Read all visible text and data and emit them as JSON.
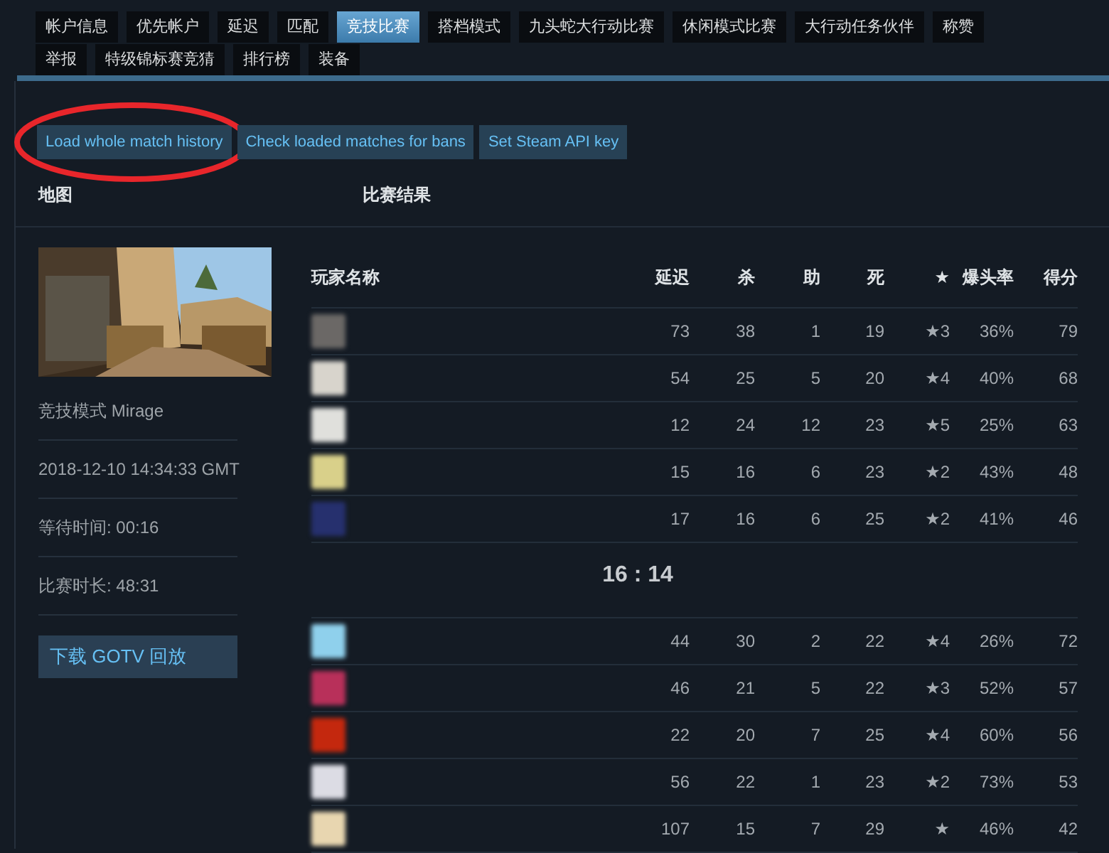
{
  "tabs": [
    {
      "label": "帐户信息",
      "selected": false
    },
    {
      "label": "优先帐户",
      "selected": false
    },
    {
      "label": "延迟",
      "selected": false
    },
    {
      "label": "匹配",
      "selected": false
    },
    {
      "label": "竞技比赛",
      "selected": true
    },
    {
      "label": "搭档模式",
      "selected": false
    },
    {
      "label": "九头蛇大行动比赛",
      "selected": false
    },
    {
      "label": "休闲模式比赛",
      "selected": false
    },
    {
      "label": "大行动任务伙伴",
      "selected": false
    },
    {
      "label": "称赞",
      "selected": false
    },
    {
      "label": "举报",
      "selected": false
    },
    {
      "label": "特级锦标赛竞猜",
      "selected": false
    },
    {
      "label": "排行榜",
      "selected": false
    },
    {
      "label": "装备",
      "selected": false
    }
  ],
  "actions": [
    {
      "label": "Load whole match history",
      "circled": true
    },
    {
      "label": "Check loaded matches for bans",
      "circled": false
    },
    {
      "label": "Set Steam API key",
      "circled": false
    }
  ],
  "map_panel": {
    "heading": "地图",
    "map_image": {
      "kind": "picture"
    },
    "details": [
      "竞技模式 Mirage",
      "2018-12-10 14:34:33 GMT",
      "等待时间: 00:16",
      "比赛时长: 48:31"
    ],
    "download_button": "下载 GOTV 回放"
  },
  "results": {
    "heading": "比赛结果",
    "columns": [
      "玩家名称",
      "延迟",
      "杀",
      "助",
      "死",
      "★",
      "爆头率",
      "得分"
    ],
    "teams": [
      {
        "players": [
          {
            "color": "#6b6866",
            "ping": "73",
            "kills": "38",
            "assists": "1",
            "deaths": "19",
            "mvp": "★3",
            "headshots": "36%",
            "score": "79"
          },
          {
            "color": "#d8d4cc",
            "ping": "54",
            "kills": "25",
            "assists": "5",
            "deaths": "20",
            "mvp": "★4",
            "headshots": "40%",
            "score": "68"
          },
          {
            "color": "#e0e0dc",
            "ping": "12",
            "kills": "24",
            "assists": "12",
            "deaths": "23",
            "mvp": "★5",
            "headshots": "25%",
            "score": "63"
          },
          {
            "color": "#d9d08a",
            "ping": "15",
            "kills": "16",
            "assists": "6",
            "deaths": "23",
            "mvp": "★2",
            "headshots": "43%",
            "score": "48"
          },
          {
            "color": "#26306e",
            "ping": "17",
            "kills": "16",
            "assists": "6",
            "deaths": "25",
            "mvp": "★2",
            "headshots": "41%",
            "score": "46"
          }
        ]
      },
      {
        "players": [
          {
            "color": "#8fd0ec",
            "ping": "44",
            "kills": "30",
            "assists": "2",
            "deaths": "22",
            "mvp": "★4",
            "headshots": "26%",
            "score": "72"
          },
          {
            "color": "#b8305a",
            "ping": "46",
            "kills": "21",
            "assists": "5",
            "deaths": "22",
            "mvp": "★3",
            "headshots": "52%",
            "score": "57"
          },
          {
            "color": "#c4280e",
            "ping": "22",
            "kills": "20",
            "assists": "7",
            "deaths": "25",
            "mvp": "★4",
            "headshots": "60%",
            "score": "56"
          },
          {
            "color": "#dcdce4",
            "ping": "56",
            "kills": "22",
            "assists": "1",
            "deaths": "23",
            "mvp": "★2",
            "headshots": "73%",
            "score": "53"
          },
          {
            "color": "#e8d6b0",
            "ping": "107",
            "kills": "15",
            "assists": "7",
            "deaths": "29",
            "mvp": "★",
            "headshots": "46%",
            "score": "42"
          }
        ]
      }
    ],
    "score": "16 : 14"
  }
}
